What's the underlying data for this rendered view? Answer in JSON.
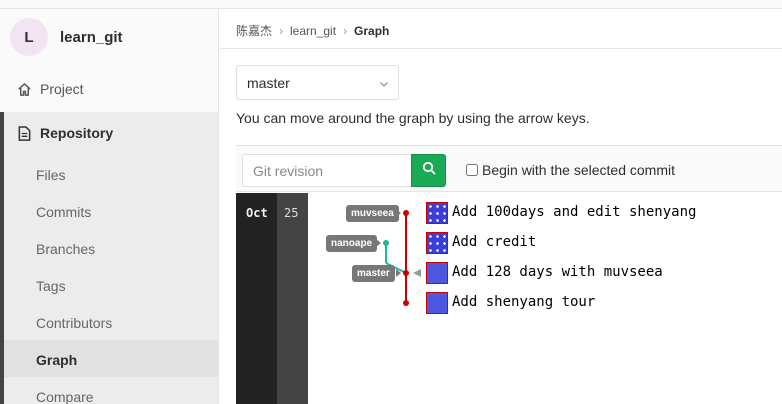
{
  "project": {
    "avatar_letter": "L",
    "name": "learn_git"
  },
  "nav": {
    "project": "Project",
    "repository": "Repository",
    "sub_items": [
      "Files",
      "Commits",
      "Branches",
      "Tags",
      "Contributors",
      "Graph",
      "Compare"
    ],
    "active_sub": "Graph"
  },
  "breadcrumb": {
    "user": "陈嘉杰",
    "repo": "learn_git",
    "current": "Graph"
  },
  "branch_select": {
    "value": "master"
  },
  "hint": "You can move around the graph by using the arrow keys.",
  "filter": {
    "placeholder": "Git revision",
    "checkbox_label": "Begin with the selected commit"
  },
  "graph": {
    "month": "Oct",
    "day": "25",
    "commits": [
      {
        "message": "Add 100days and edit shenyang",
        "ref": "muvseea",
        "avatar": "pattern"
      },
      {
        "message": "Add credit",
        "ref": "nanoape",
        "avatar": "pattern"
      },
      {
        "message": "Add 128 days with muvseea",
        "ref": "master",
        "avatar": "plain"
      },
      {
        "message": "Add shenyang tour",
        "ref": "",
        "avatar": "plain"
      }
    ]
  },
  "colors": {
    "accent_green": "#1aaa55",
    "graph_red": "#c00",
    "graph_teal": "#1abc9c",
    "avatar_blue": "#4e57e0"
  }
}
